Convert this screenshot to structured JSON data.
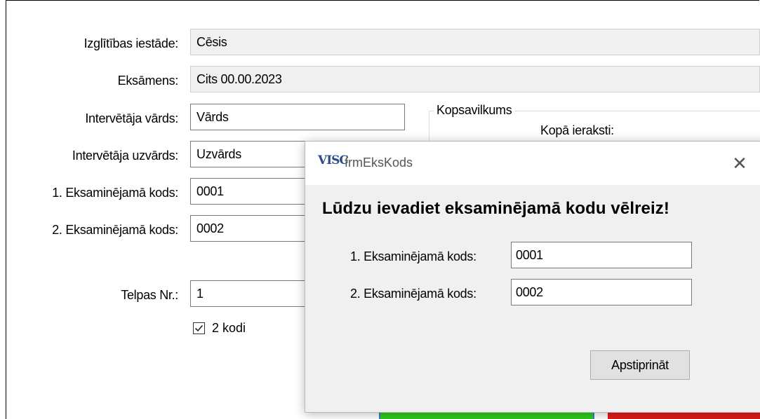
{
  "form": {
    "labels": {
      "institution": "Izglītības iestāde:",
      "exam": "Eksāmens:",
      "interviewer_first": "Intervētāja vārds:",
      "interviewer_last": "Intervētāja uzvārds:",
      "code1": "1. Eksaminējamā kods:",
      "code2": "2. Eksaminējamā kods:",
      "room": "Telpas Nr.:"
    },
    "values": {
      "institution": "Cēsis",
      "exam": "Cits 00.00.2023",
      "interviewer_first": "Vārds",
      "interviewer_last": "Uzvārds",
      "code1": "0001",
      "code2": "0002",
      "room": "1"
    },
    "checkbox": {
      "label": "2 kodi",
      "checked": true
    },
    "summary": {
      "title": "Kopsavilkums",
      "total_label": "Kopā ieraksti:"
    }
  },
  "dialog": {
    "logo": "VISC",
    "title": "frmEksKods",
    "close_glyph": "✕",
    "heading": "Lūdzu ievadiet eksaminējamā kodu vēlreiz!",
    "code1_label": "1. Eksaminējamā kods:",
    "code1_value": "0001",
    "code2_label": "2. Eksaminējamā kods:",
    "code2_value": "0002",
    "confirm_button": "Apstiprināt"
  },
  "colors": {
    "green_button": "#2ecc1e",
    "red_button": "#e01b1b",
    "focus_border": "#3a78d6",
    "logo": "#2a4c8c"
  }
}
